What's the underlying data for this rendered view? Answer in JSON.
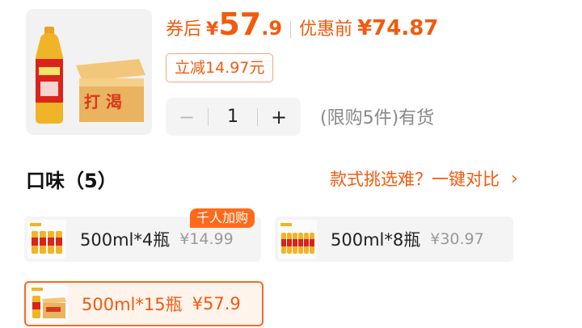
{
  "product": {
    "image_icon": "tea-bottle-and-box-icon",
    "coupon_label": "券后",
    "coupon_currency": "¥",
    "coupon_price_int": "57",
    "coupon_price_dec": ".9",
    "before_label": "优惠前",
    "before_price": "¥74.87",
    "discount_tag": "立减14.97元"
  },
  "quantity": {
    "minus": "−",
    "value": "1",
    "plus": "+",
    "stock_text": "(限购5件)有货"
  },
  "flavor": {
    "title": "口味（5）",
    "compare_link": "款式挑选难？一键对比",
    "compare_chevron": "›",
    "promo_badge": "千人加购",
    "options": [
      {
        "name": "500ml*4瓶",
        "price": "¥14.99"
      },
      {
        "name": "500ml*8瓶",
        "price": "¥30.97"
      },
      {
        "name": "500ml*15瓶",
        "price": "¥57.9"
      }
    ]
  },
  "colors": {
    "accent": "#f25a0d",
    "badge": "#ff6a1a",
    "gray_text": "#888888"
  }
}
